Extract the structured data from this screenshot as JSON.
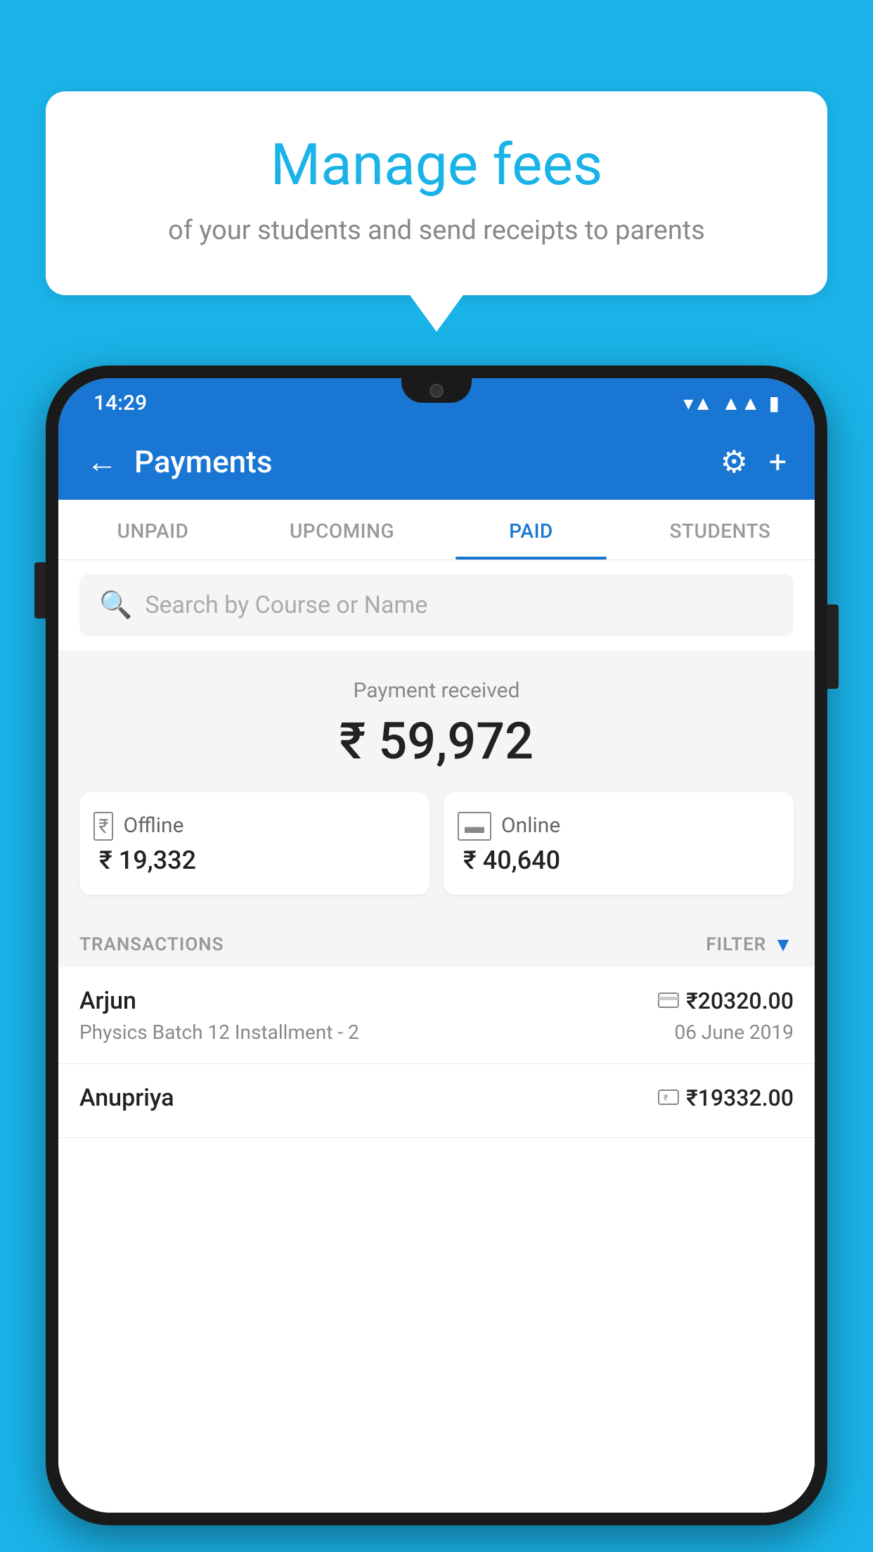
{
  "background_color": "#1ab3e8",
  "bubble": {
    "title": "Manage fees",
    "subtitle": "of your students and send receipts to parents"
  },
  "status_bar": {
    "time": "14:29",
    "icons": [
      "wifi",
      "signal",
      "battery"
    ]
  },
  "app_bar": {
    "title": "Payments",
    "back_label": "←",
    "gear_label": "⚙",
    "plus_label": "+"
  },
  "tabs": [
    {
      "label": "UNPAID",
      "active": false
    },
    {
      "label": "UPCOMING",
      "active": false
    },
    {
      "label": "PAID",
      "active": true
    },
    {
      "label": "STUDENTS",
      "active": false
    }
  ],
  "search": {
    "placeholder": "Search by Course or Name"
  },
  "payment_received": {
    "label": "Payment received",
    "total": "₹ 59,972",
    "offline": {
      "type": "Offline",
      "amount": "₹ 19,332"
    },
    "online": {
      "type": "Online",
      "amount": "₹ 40,640"
    }
  },
  "transactions_section": {
    "label": "TRANSACTIONS",
    "filter_label": "FILTER"
  },
  "transactions": [
    {
      "name": "Arjun",
      "course": "Physics Batch 12 Installment - 2",
      "amount": "₹20320.00",
      "date": "06 June 2019",
      "payment_icon": "card"
    },
    {
      "name": "Anupriya",
      "course": "",
      "amount": "₹19332.00",
      "date": "",
      "payment_icon": "cash"
    }
  ]
}
